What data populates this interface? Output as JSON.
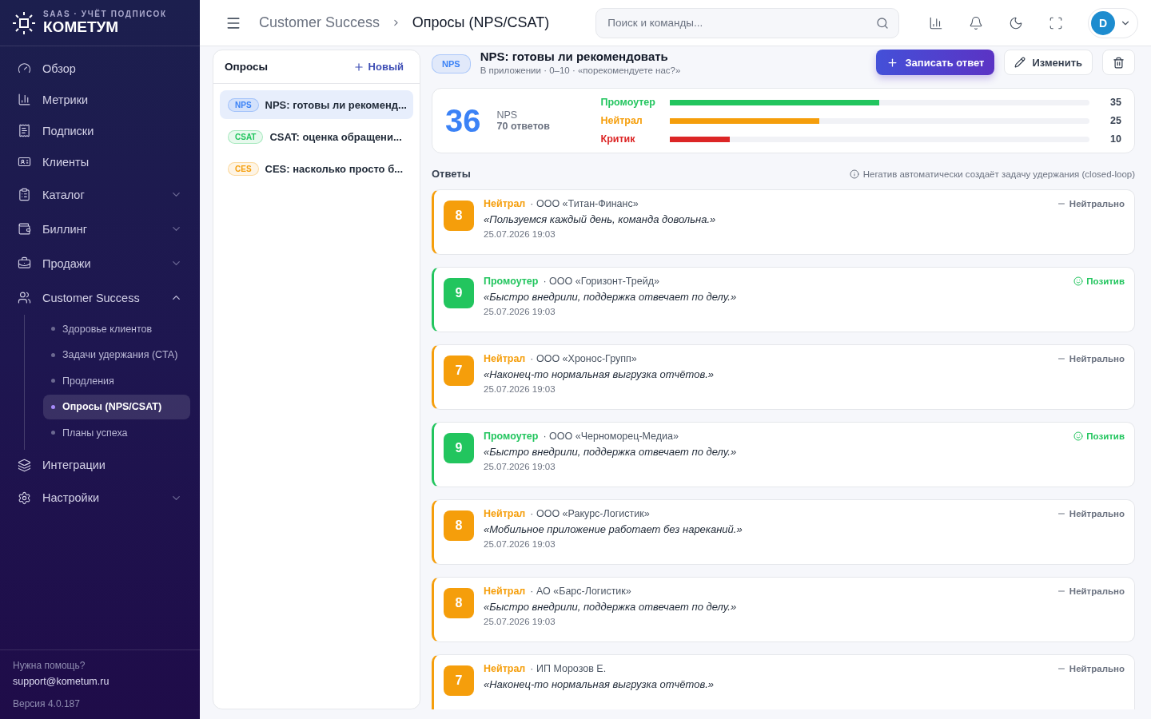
{
  "brand": {
    "tagline": "SAAS · УЧЁТ ПОДПИСОК",
    "name": "КОМЕТУМ"
  },
  "nav": [
    {
      "label": "Обзор",
      "selected": false
    },
    {
      "label": "Метрики",
      "selected": false
    },
    {
      "label": "Подписки",
      "selected": false
    },
    {
      "label": "Клиенты",
      "selected": false
    },
    {
      "label": "Каталог",
      "selected": false,
      "expanded": false
    },
    {
      "label": "Биллинг",
      "selected": false,
      "expanded": false
    },
    {
      "label": "Продажи",
      "selected": false,
      "expanded": false
    },
    {
      "label": "Customer Success",
      "selected": false,
      "expanded": true,
      "children": [
        {
          "label": "Здоровье клиентов",
          "selected": false
        },
        {
          "label": "Задачи удержания (CTA)",
          "selected": false
        },
        {
          "label": "Продления",
          "selected": false
        },
        {
          "label": "Опросы (NPS/CSAT)",
          "selected": true
        },
        {
          "label": "Планы успеха",
          "selected": false
        }
      ]
    },
    {
      "label": "Интеграции",
      "selected": false
    },
    {
      "label": "Настройки",
      "selected": false,
      "expanded": false
    }
  ],
  "sidebar_footer": {
    "help": "Нужна помощь?",
    "email": "support@kometum.ru",
    "version": "Версия 4.0.187"
  },
  "breadcrumb": [
    "Customer Success",
    "Опросы (NPS/CSAT)"
  ],
  "search": {
    "placeholder": "Поиск и команды..."
  },
  "user": {
    "initial": "D"
  },
  "surveys": {
    "title": "Опросы",
    "new_button": "Новый",
    "items": [
      {
        "tag": "NPS",
        "color": "#3b82f6",
        "title": "NPS: готовы ли рекоменд...",
        "selected": true
      },
      {
        "tag": "CSAT",
        "color": "#22c55e",
        "title": "CSAT: оценка обращени...",
        "selected": false
      },
      {
        "tag": "CES",
        "color": "#f59e0b",
        "title": "CES: насколько просто б...",
        "selected": false
      }
    ]
  },
  "survey": {
    "tag": "NPS",
    "title": "NPS: готовы ли рекомендовать",
    "subtitle": "В приложении · 0–10 · «порекомендуете нас?»",
    "record_button": "Записать ответ",
    "edit_button": "Изменить"
  },
  "score": {
    "value": "36",
    "label": "NPS",
    "count": "70 ответов",
    "groups": [
      {
        "label": "Промоутер",
        "color": "#22c55e",
        "level": 0.5,
        "count": "35"
      },
      {
        "label": "Нейтрал",
        "color": "#f59e0b",
        "level": 0.357,
        "count": "25"
      },
      {
        "label": "Критик",
        "color": "#dc2626",
        "level": 0.143,
        "count": "10"
      }
    ]
  },
  "responses": {
    "title": "Ответы",
    "note": "Негатив автоматически создаёт задачу удержания (closed-loop)",
    "items": [
      {
        "score": "8",
        "kind": "neutral",
        "group": "Нейтрал",
        "company": "· ООО «Титан-Финанс»",
        "quote": "«Пользуемся каждый день, команда довольна.»",
        "date": "25.07.2026 19:03",
        "sentiment": {
          "kind": "neutral",
          "label": "Нейтрально"
        }
      },
      {
        "score": "9",
        "kind": "promoter",
        "group": "Промоутер",
        "company": "· ООО «Горизонт-Трейд»",
        "quote": "«Быстро внедрили, поддержка отвечает по делу.»",
        "date": "25.07.2026 19:03",
        "sentiment": {
          "kind": "positive",
          "label": "Позитив"
        }
      },
      {
        "score": "7",
        "kind": "neutral",
        "group": "Нейтрал",
        "company": "· ООО «Хронос-Групп»",
        "quote": "«Наконец-то нормальная выгрузка отчётов.»",
        "date": "25.07.2026 19:03",
        "sentiment": {
          "kind": "neutral",
          "label": "Нейтрально"
        }
      },
      {
        "score": "9",
        "kind": "promoter",
        "group": "Промоутер",
        "company": "· ООО «Черноморец-Медиа»",
        "quote": "«Быстро внедрили, поддержка отвечает по делу.»",
        "date": "25.07.2026 19:03",
        "sentiment": {
          "kind": "positive",
          "label": "Позитив"
        }
      },
      {
        "score": "8",
        "kind": "neutral",
        "group": "Нейтрал",
        "company": "· ООО «Ракурс-Логистик»",
        "quote": "«Мобильное приложение работает без нареканий.»",
        "date": "25.07.2026 19:03",
        "sentiment": {
          "kind": "neutral",
          "label": "Нейтрально"
        }
      },
      {
        "score": "8",
        "kind": "neutral",
        "group": "Нейтрал",
        "company": "· АО «Барс-Логистик»",
        "quote": "«Быстро внедрили, поддержка отвечает по делу.»",
        "date": "25.07.2026 19:03",
        "sentiment": {
          "kind": "neutral",
          "label": "Нейтрально"
        }
      },
      {
        "score": "7",
        "kind": "neutral",
        "group": "Нейтрал",
        "company": "· ИП Морозов Е.",
        "quote": "«Наконец-то нормальная выгрузка отчётов.»",
        "sentiment": {
          "kind": "neutral",
          "label": "Нейтрально"
        }
      }
    ]
  }
}
